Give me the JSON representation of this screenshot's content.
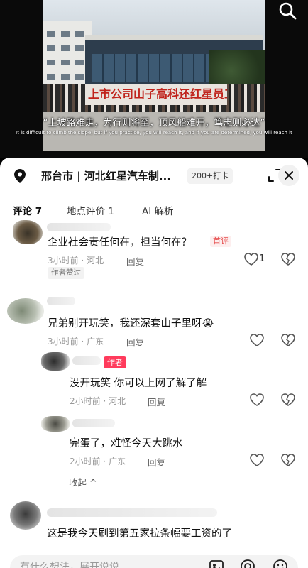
{
  "video": {
    "banner_text": "上市公司山子高科还红星员工工资",
    "subtitle_cn": "“上坡路难走，为行则将至，顶风船难开，笃志则必达”",
    "subtitle_en": "It is difficult to climb the slope, but if you practice, you will reach it, and if you are determined, you will reach it"
  },
  "header": {
    "location": "邢台市 | 河北红星汽车制...",
    "checkin_badge": "200+打卡"
  },
  "tabs": [
    {
      "label": "评论 7",
      "active": true
    },
    {
      "label": "地点评价 1",
      "active": false
    },
    {
      "label": "AI 解析",
      "active": false
    }
  ],
  "comments": [
    {
      "text": "企业社会责任何在，担当何在？",
      "tag": "首评",
      "time": "3小时前 · 河北",
      "reply": "回复",
      "likes": "1",
      "author_liked": "作者赞过"
    },
    {
      "text": "兄弟别开玩笑，我还深套山子里呀😭",
      "time": "3小时前 · 广东",
      "reply": "回复"
    },
    {
      "text": "没开玩笑  你可以上网了解了解",
      "author_tag": "作者",
      "time": "2小时前 · 河北",
      "reply": "回复"
    },
    {
      "text": "完蛋了，难怪今天大跳水",
      "time": "2小时前 · 广东",
      "reply": "回复"
    },
    {
      "collapse": "收起 ^"
    },
    {
      "text": "这是我今天刷到第五家拉条幅要工资的了"
    }
  ],
  "input": {
    "placeholder": "有什么想法，展开说说"
  },
  "colors": {
    "accent": "#ff3b5c",
    "first_tag": "#e64b4b"
  }
}
